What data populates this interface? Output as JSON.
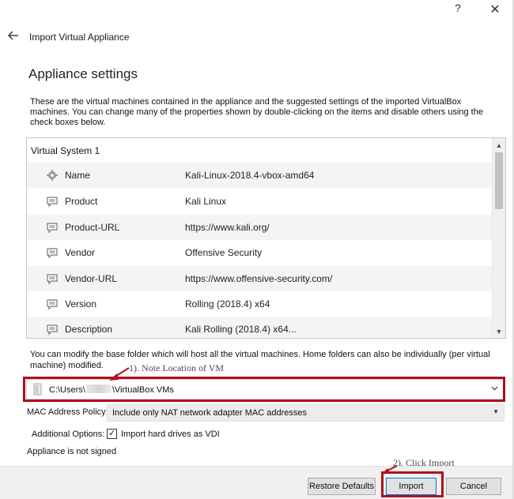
{
  "window": {
    "help_label": "?",
    "close_label": "✕"
  },
  "nav": {
    "title": "Import Virtual Appliance"
  },
  "heading": "Appliance settings",
  "intro": "These are the virtual machines contained in the appliance and the suggested settings of the imported VirtualBox machines. You can change many of the properties shown by double-clicking on the items and disable others using the check boxes below.",
  "virtual_system": {
    "header": "Virtual System 1",
    "rows": [
      {
        "key": "Name",
        "value": "Kali-Linux-2018.4-vbox-amd64",
        "icon": "gear-icon"
      },
      {
        "key": "Product",
        "value": "Kali Linux",
        "icon": "speech-bubble-icon"
      },
      {
        "key": "Product-URL",
        "value": "https://www.kali.org/",
        "icon": "speech-bubble-icon"
      },
      {
        "key": "Vendor",
        "value": "Offensive Security",
        "icon": "speech-bubble-icon"
      },
      {
        "key": "Vendor-URL",
        "value": "https://www.offensive-security.com/",
        "icon": "speech-bubble-icon"
      },
      {
        "key": "Version",
        "value": "Rolling (2018.4) x64",
        "icon": "speech-bubble-icon"
      },
      {
        "key": "Description",
        "value": "Kali Rolling (2018.4) x64...",
        "icon": "speech-bubble-icon"
      }
    ]
  },
  "base_folder": {
    "note": "You can modify the base folder which will host all the virtual machines. Home folders can also be individually (per virtual machine) modified.",
    "path_prefix": "C:\\Users\\",
    "path_suffix": "\\VirtualBox VMs"
  },
  "annotations": {
    "note_location": "1). Note Location of VM",
    "click_import": "2). Click Import",
    "color": "#b0101c"
  },
  "mac_policy": {
    "label": "MAC Address Policy:",
    "value": "Include only NAT network adapter MAC addresses"
  },
  "additional_options": {
    "label": "Additional Options:",
    "import_vdi_label": "Import hard drives as VDI",
    "import_vdi_checked": true
  },
  "signature_status": "Appliance is not signed",
  "buttons": {
    "restore_defaults": "Restore Defaults",
    "import": "Import",
    "cancel": "Cancel"
  }
}
